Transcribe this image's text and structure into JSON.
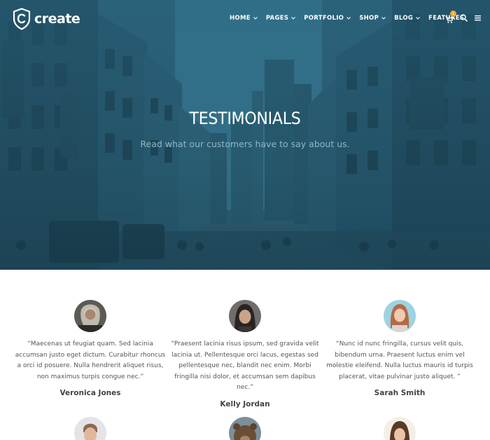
{
  "brand": {
    "name": "create",
    "logo_letter": "C"
  },
  "nav": {
    "items": [
      {
        "label": "HOME",
        "has_dropdown": true
      },
      {
        "label": "PAGES",
        "has_dropdown": true
      },
      {
        "label": "PORTFOLIO",
        "has_dropdown": true
      },
      {
        "label": "SHOP",
        "has_dropdown": true
      },
      {
        "label": "BLOG",
        "has_dropdown": true
      },
      {
        "label": "FEATURES",
        "has_dropdown": false
      }
    ],
    "cart_count": "1",
    "icons": [
      "cart-icon",
      "search-icon",
      "menu-icon"
    ]
  },
  "hero": {
    "title": "TESTIMONIALS",
    "subtitle": "Read what our customers have to say about us."
  },
  "testimonials": [
    {
      "quote": "“Maecenas ut feugiat quam. Sed lacinia accumsan justo eget dictum. Curabitur rhoncus a orci id posuere. Nulla hendrerit aliquet risus, non maximus turpis congue nec.”",
      "name": "Veronica Jones"
    },
    {
      "quote": "“Praesent lacinia risus ipsum, sed gravida velit lacinia ut. Pellentesque orci lacus, egestas sed pellentesque nec, blandit nec enim. Morbi fringilla nisi dolor, et accumsan sem dapibus nec.”",
      "name": "Kelly Jordan"
    },
    {
      "quote": "“Nunc id nunc fringilla, cursus velit quis, bibendum urna. Praesent luctus enim vel molestie eleifend. Nulla luctus mauris id turpis placerat, vitae pulvinar justo aliquet. ”",
      "name": "Sarah Smith"
    }
  ],
  "colors": {
    "hero_tint": "#2c5b70",
    "accent_badge": "#f0a72f",
    "subtitle": "#8fb6c7"
  }
}
